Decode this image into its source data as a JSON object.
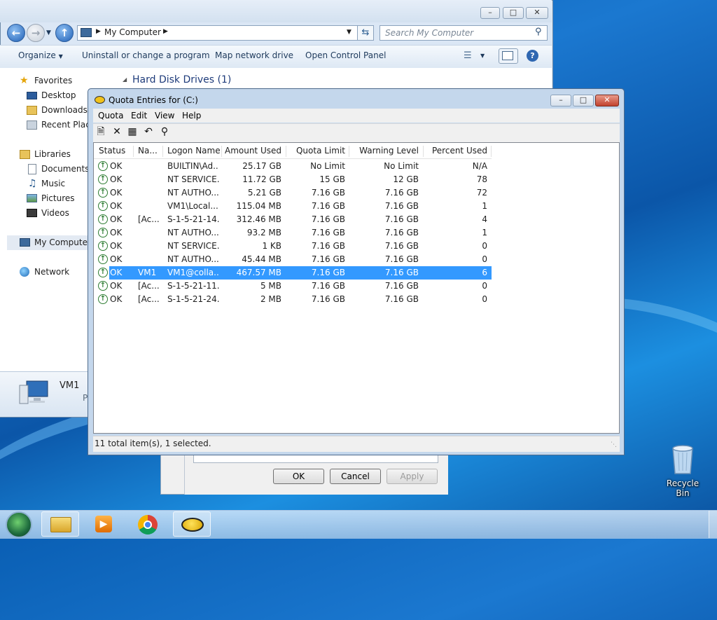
{
  "explorer": {
    "address_segments": [
      "My Computer"
    ],
    "search_placeholder": "Search My Computer",
    "commands": [
      "Organize",
      "Uninstall or change a program",
      "Map network drive",
      "Open Control Panel"
    ],
    "nav": {
      "favorites": "Favorites",
      "desktop": "Desktop",
      "downloads": "Downloads",
      "recent": "Recent Places",
      "libraries": "Libraries",
      "documents": "Documents",
      "music": "Music",
      "pictures": "Pictures",
      "videos": "Videos",
      "my_computer": "My Computer",
      "network": "Network"
    },
    "group_header": "Hard Disk Drives (1)",
    "details_name": "VM1",
    "details_sub": "P"
  },
  "quota_window": {
    "title": "Quota Entries for  (C:)",
    "menu": [
      "Quota",
      "Edit",
      "View",
      "Help"
    ],
    "columns": [
      "Status",
      "Na...",
      "Logon Name",
      "Amount Used",
      "Quota Limit",
      "Warning Level",
      "Percent Used"
    ],
    "rows": [
      {
        "status": "OK",
        "name": "",
        "logon": "BUILTIN\\Ad...",
        "used": "25.17 GB",
        "limit": "No Limit",
        "warning": "No Limit",
        "percent": "N/A"
      },
      {
        "status": "OK",
        "name": "",
        "logon": "NT SERVICE...",
        "used": "11.72 GB",
        "limit": "15 GB",
        "warning": "12 GB",
        "percent": "78"
      },
      {
        "status": "OK",
        "name": "",
        "logon": "NT AUTHO...",
        "used": "5.21 GB",
        "limit": "7.16 GB",
        "warning": "7.16 GB",
        "percent": "72"
      },
      {
        "status": "OK",
        "name": "",
        "logon": "VM1\\Local...",
        "used": "115.04 MB",
        "limit": "7.16 GB",
        "warning": "7.16 GB",
        "percent": "1"
      },
      {
        "status": "OK",
        "name": "[Ac...",
        "logon": "S-1-5-21-14...",
        "used": "312.46 MB",
        "limit": "7.16 GB",
        "warning": "7.16 GB",
        "percent": "4"
      },
      {
        "status": "OK",
        "name": "",
        "logon": "NT AUTHO...",
        "used": "93.2 MB",
        "limit": "7.16 GB",
        "warning": "7.16 GB",
        "percent": "1"
      },
      {
        "status": "OK",
        "name": "",
        "logon": "NT SERVICE...",
        "used": "1 KB",
        "limit": "7.16 GB",
        "warning": "7.16 GB",
        "percent": "0"
      },
      {
        "status": "OK",
        "name": "",
        "logon": "NT AUTHO...",
        "used": "45.44 MB",
        "limit": "7.16 GB",
        "warning": "7.16 GB",
        "percent": "0"
      },
      {
        "status": "OK",
        "name": "VM1",
        "logon": "VM1@colla...",
        "used": "467.57 MB",
        "limit": "7.16 GB",
        "warning": "7.16 GB",
        "percent": "6"
      },
      {
        "status": "OK",
        "name": "[Ac...",
        "logon": "S-1-5-21-11...",
        "used": "5 MB",
        "limit": "7.16 GB",
        "warning": "7.16 GB",
        "percent": "0"
      },
      {
        "status": "OK",
        "name": "[Ac...",
        "logon": "S-1-5-21-24...",
        "used": "2 MB",
        "limit": "7.16 GB",
        "warning": "7.16 GB",
        "percent": "0"
      }
    ],
    "selected_row": 8,
    "status_text": "11 total item(s), 1 selected."
  },
  "properties_dialog": {
    "ok": "OK",
    "cancel": "Cancel",
    "apply": "Apply"
  },
  "desktop": {
    "recycle_bin": "Recycle Bin"
  },
  "colors": {
    "selection": "#3399ff",
    "ok_icon": "#2e7d32"
  }
}
